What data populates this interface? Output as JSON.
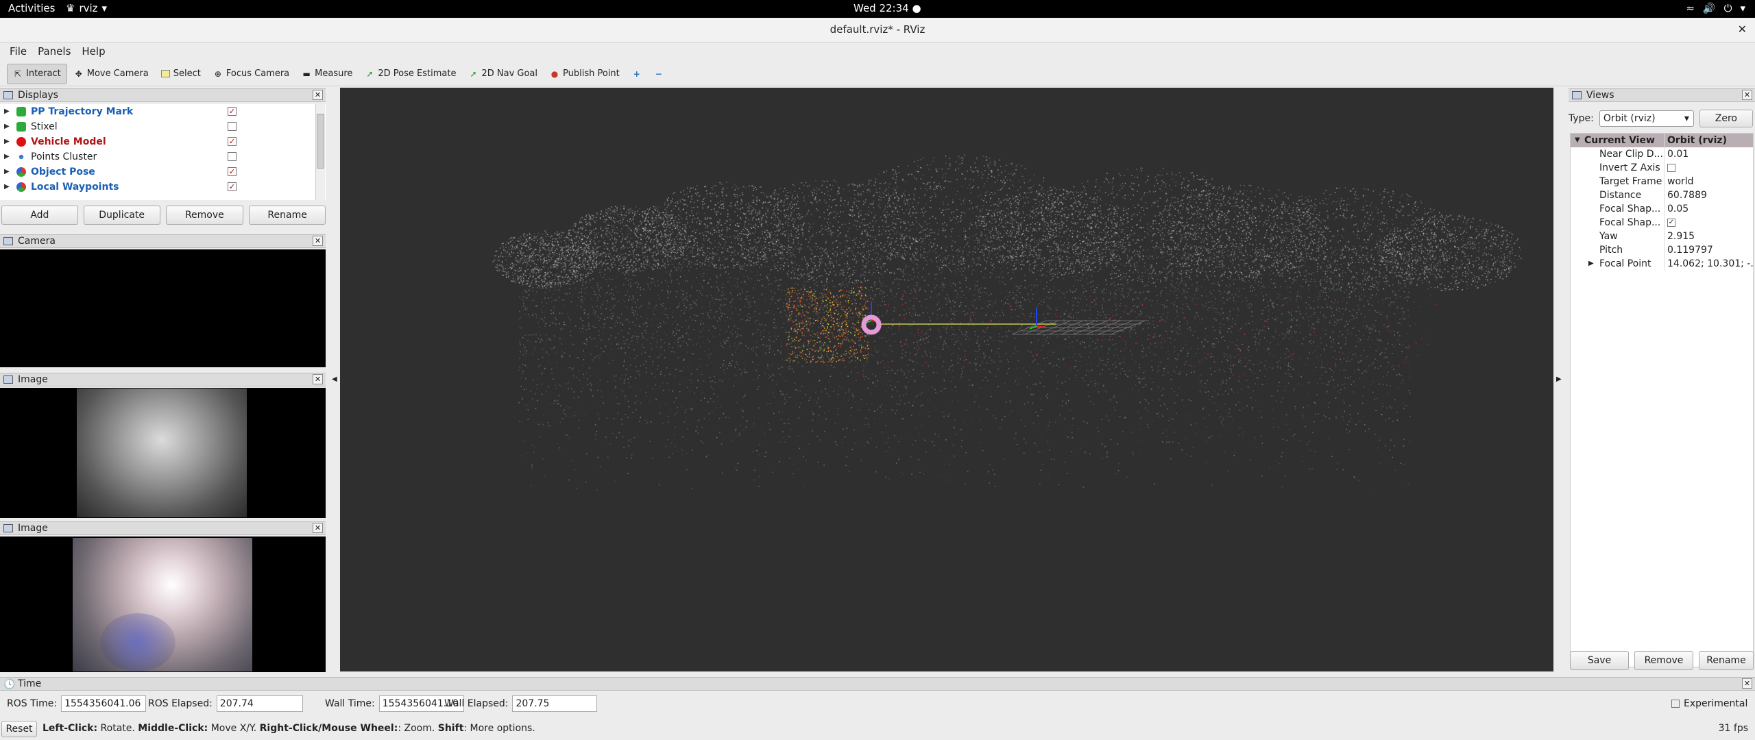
{
  "topbar": {
    "activities": "Activities",
    "app_name": "rviz",
    "clock": "Wed 22:34 ●"
  },
  "window": {
    "title": "default.rviz* - RViz"
  },
  "menu": [
    "File",
    "Panels",
    "Help"
  ],
  "toolbar": {
    "interact": "Interact",
    "move_camera": "Move Camera",
    "select": "Select",
    "focus_camera": "Focus Camera",
    "measure": "Measure",
    "pose_estimate": "2D Pose Estimate",
    "nav_goal": "2D Nav Goal",
    "publish_point": "Publish Point"
  },
  "displays": {
    "title": "Displays",
    "items": [
      {
        "label": "PP Trajectory Mark",
        "checked": true
      },
      {
        "label": "Stixel",
        "checked": false
      },
      {
        "label": "Vehicle Model",
        "checked": true
      },
      {
        "label": "Points Cluster",
        "checked": false
      },
      {
        "label": "Object Pose",
        "checked": true
      },
      {
        "label": "Local Waypoints",
        "checked": true
      }
    ],
    "buttons": {
      "add": "Add",
      "duplicate": "Duplicate",
      "remove": "Remove",
      "rename": "Rename"
    }
  },
  "camera_panel": {
    "title": "Camera"
  },
  "image_panel_1": {
    "title": "Image"
  },
  "image_panel_2": {
    "title": "Image"
  },
  "views": {
    "title": "Views",
    "type_label": "Type:",
    "type_value": "Orbit (rviz)",
    "zero": "Zero",
    "current_view": {
      "key": "Current View",
      "value": "Orbit (rviz)"
    },
    "props": [
      {
        "key": "Near Clip D...",
        "value": "0.01"
      },
      {
        "key": "Invert Z Axis",
        "value": ""
      },
      {
        "key": "Target Frame",
        "value": "world"
      },
      {
        "key": "Distance",
        "value": "60.7889"
      },
      {
        "key": "Focal Shap...",
        "value": "0.05"
      },
      {
        "key": "Focal Shap...",
        "value": ""
      },
      {
        "key": "Yaw",
        "value": "2.915"
      },
      {
        "key": "Pitch",
        "value": "0.119797"
      },
      {
        "key": "Focal Point",
        "value": "14.062; 10.301; -..."
      }
    ],
    "buttons": {
      "save": "Save",
      "remove": "Remove",
      "rename": "Rename"
    }
  },
  "time": {
    "title": "Time",
    "ros_time_label": "ROS Time:",
    "ros_time": "1554356041.06",
    "ros_elapsed_label": "ROS Elapsed:",
    "ros_elapsed": "207.74",
    "wall_time_label": "Wall Time:",
    "wall_time": "1554356041.10",
    "wall_elapsed_label": "Wall Elapsed:",
    "wall_elapsed": "207.75",
    "experimental": "Experimental"
  },
  "status": {
    "reset": "Reset",
    "b1": "Left-Click:",
    "t1": " Rotate. ",
    "b2": "Middle-Click:",
    "t2": " Move X/Y. ",
    "b3": "Right-Click/Mouse Wheel:",
    "t3": ": Zoom. ",
    "b4": "Shift",
    "t4": ": More options.",
    "fps": "31 fps"
  }
}
